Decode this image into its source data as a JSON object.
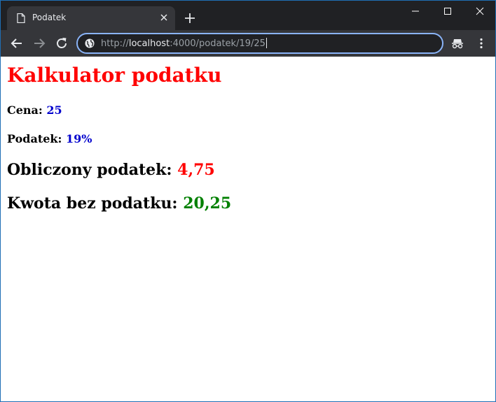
{
  "browser": {
    "tab_title": "Podatek",
    "url_prefix": "http://",
    "url_host": "localhost",
    "url_rest": ":4000/podatek/19/25"
  },
  "page": {
    "heading": "Kalkulator podatku",
    "price_label": "Cena:",
    "price_value": "25",
    "tax_label": "Podatek:",
    "tax_value": "19%",
    "computed_tax_label": "Obliczony podatek:",
    "computed_tax_value": "4,75",
    "net_amount_label": "Kwota bez podatku:",
    "net_amount_value": "20,25"
  },
  "colors": {
    "heading": "#ff0000",
    "input_values": "#0000cd",
    "computed_tax_value": "#ff0000",
    "net_amount_value": "#008000",
    "omnibox_focus": "#8ab4f8"
  }
}
